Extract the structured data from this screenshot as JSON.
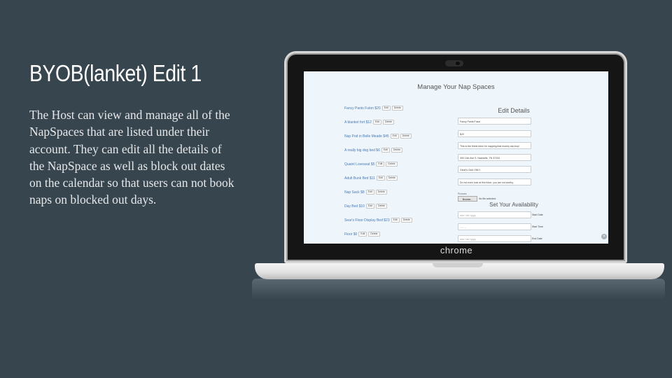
{
  "slide": {
    "title": "BYOB(lanket) Edit 1",
    "body": "The Host can view and manage all of the NapSpaces that are listed under their account. They can edit all the details of the NapSpace as well as block out dates on the calendar so that users can not book naps on blocked out days."
  },
  "device": {
    "brand": "chrome"
  },
  "app": {
    "page_title": "Manage Your Nap Spaces",
    "edit_label": "Edit",
    "delete_label": "Delete",
    "nap_spaces": [
      "Fancy Pants Futon $20",
      "A blanket fort $12",
      "Nap Pod in Belle Meade $45",
      "A really big dog bed $6",
      "Quaint Loveseat $5",
      "Adult Bunk Bed $11",
      "Nap Sack $8",
      "Day Bed $10",
      "Sear's Floor Display Bed $23",
      "Floor $0"
    ],
    "edit_details": {
      "title": "Edit Details",
      "name_value": "Fancy Pants Futon",
      "price_value": "$20",
      "description_value": "This is the finest futon for napping that money can buy!",
      "address_value": "300 11th Ave S. Nashville, TN 37203",
      "restriction_value": "Giner's Club ONLY",
      "note_value": "Do not even look at this futon, you are not worthy.",
      "pictures_label": "Pictures",
      "browse_label": "Browse...",
      "no_file_label": "No file selected."
    },
    "availability": {
      "title": "Set Your Availability",
      "start_date_placeholder": "mm / dd / yyyy",
      "start_date_label": "Start Date",
      "start_time_placeholder": "--:-- --",
      "start_time_label": "Start Time",
      "end_date_placeholder": "mm / dd / yyyy",
      "end_date_label": "End Date"
    },
    "close_icon": "×"
  },
  "colors": {
    "background": "#37454f",
    "screen_background": "#eef5fb",
    "link": "#4a7ab3"
  }
}
